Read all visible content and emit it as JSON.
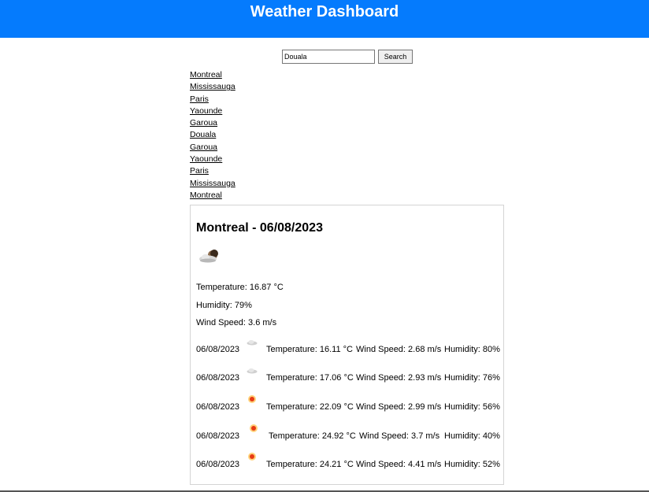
{
  "header": {
    "title": "Weather Dashboard"
  },
  "search": {
    "value": "Douala",
    "button_label": "Search"
  },
  "history": [
    "Montreal",
    "Mississauga",
    "Paris",
    "Yaounde",
    "Garoua",
    "Douala",
    "Garoua",
    "Yaounde",
    "Paris",
    "Mississauga",
    "Montreal"
  ],
  "current": {
    "title": "Montreal - 06/08/2023",
    "icon": "cloud-moon-icon",
    "temperature": "Temperature: 16.87 °C",
    "humidity": "Humidity: 79%",
    "wind": "Wind Speed: 3.6 m/s"
  },
  "forecast": [
    {
      "date": "06/08/2023",
      "icon": "cloud-icon",
      "temp": "Temperature: 16.11 °C",
      "wind": "Wind Speed: 2.68 m/s",
      "humidity": "Humidity: 80%"
    },
    {
      "date": "06/08/2023",
      "icon": "cloud-icon",
      "temp": "Temperature: 17.06 °C",
      "wind": "Wind Speed: 2.93 m/s",
      "humidity": "Humidity: 76%"
    },
    {
      "date": "06/08/2023",
      "icon": "sun-icon",
      "temp": "Temperature: 22.09 °C",
      "wind": "Wind Speed: 2.99 m/s",
      "humidity": "Humidity: 56%"
    },
    {
      "date": "06/08/2023",
      "icon": "sun-icon",
      "temp": "Temperature: 24.92 °C",
      "wind": "Wind Speed: 3.7 m/s",
      "humidity": "Humidity: 40%"
    },
    {
      "date": "06/08/2023",
      "icon": "sun-icon",
      "temp": "Temperature: 24.21 °C",
      "wind": "Wind Speed: 4.41 m/s",
      "humidity": "Humidity: 52%"
    }
  ],
  "colors": {
    "header_bg": "#057bfd",
    "header_text": "#ffffff"
  }
}
